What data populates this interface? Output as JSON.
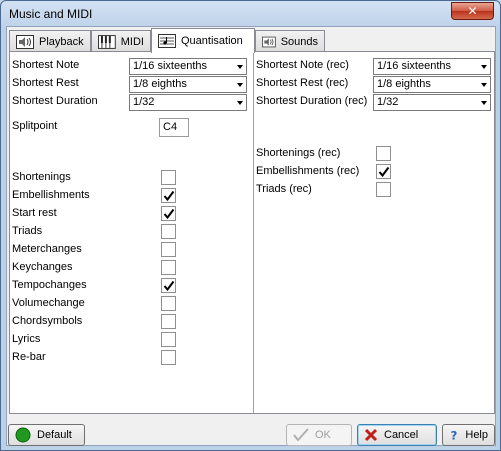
{
  "window": {
    "title": "Music and MIDI",
    "close_glyph": "✕"
  },
  "tabs": [
    {
      "label": "Playback",
      "icon": "speaker-icon"
    },
    {
      "label": "MIDI",
      "icon": "piano-icon"
    },
    {
      "label": "Quantisation",
      "icon": "score-icon"
    },
    {
      "label": "Sounds",
      "icon": "speaker-icon"
    }
  ],
  "left": {
    "shortest_note": {
      "label": "Shortest Note",
      "value": "1/16 sixteenths"
    },
    "shortest_rest": {
      "label": "Shortest Rest",
      "value": "1/8  eighths"
    },
    "shortest_duration": {
      "label": "Shortest Duration",
      "value": "1/32"
    },
    "splitpoint": {
      "label": "Splitpoint",
      "value": "C4"
    },
    "checks": [
      {
        "label": "Shortenings",
        "checked": false
      },
      {
        "label": "Embellishments",
        "checked": true
      },
      {
        "label": "Start rest",
        "checked": true
      },
      {
        "label": "Triads",
        "checked": false
      },
      {
        "label": "Meterchanges",
        "checked": false
      },
      {
        "label": "Keychanges",
        "checked": false
      },
      {
        "label": "Tempochanges",
        "checked": true
      },
      {
        "label": "Volumechange",
        "checked": false
      },
      {
        "label": "Chordsymbols",
        "checked": false
      },
      {
        "label": "Lyrics",
        "checked": false
      },
      {
        "label": "Re-bar",
        "checked": false
      }
    ]
  },
  "right": {
    "shortest_note": {
      "label": "Shortest Note (rec)",
      "value": "1/16 sixteenths"
    },
    "shortest_rest": {
      "label": "Shortest Rest (rec)",
      "value": "1/8  eighths"
    },
    "shortest_duration": {
      "label": "Shortest Duration (rec)",
      "value": "1/32"
    },
    "checks": [
      {
        "label": "Shortenings (rec)",
        "checked": false
      },
      {
        "label": "Embellishments (rec)",
        "checked": true
      },
      {
        "label": "Triads (rec)",
        "checked": false
      }
    ]
  },
  "buttons": {
    "default": "Default",
    "ok": "OK",
    "cancel": "Cancel",
    "help": "Help"
  },
  "colors": {
    "default_icon": "#1f9a1f",
    "cancel_icon": "#c0201a",
    "help_icon": "#2a64b8"
  }
}
